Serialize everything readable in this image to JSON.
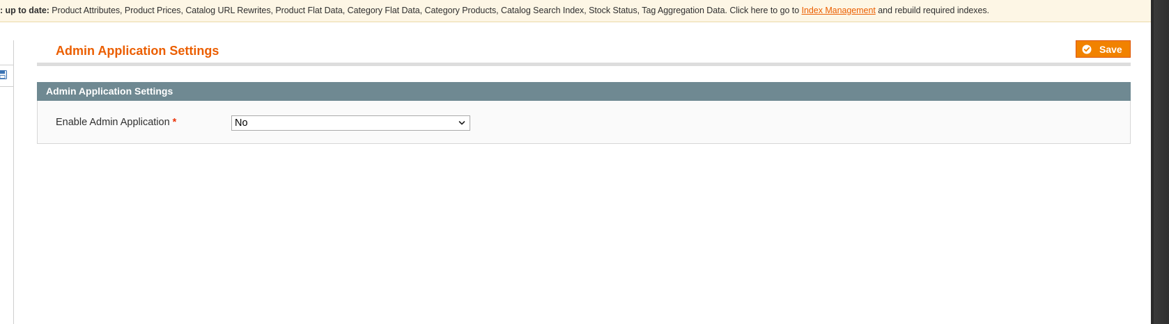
{
  "notice": {
    "prefix": ": up to date:",
    "message": " Product Attributes, Product Prices, Catalog URL Rewrites, Product Flat Data, Category Flat Data, Category Products, Catalog Search Index, Stock Status, Tag Aggregation Data. Click here to go to ",
    "link_text": "Index Management",
    "suffix": " and rebuild required indexes."
  },
  "page": {
    "title": "Admin Application Settings",
    "save_label": "Save"
  },
  "section": {
    "header": "Admin Application Settings",
    "fields": [
      {
        "label": "Enable Admin Application",
        "required_mark": "*",
        "value": "No"
      }
    ]
  },
  "icons": {
    "save_check": "check-circle-icon",
    "chevron": "chevron-down-icon",
    "left_panel": "floppy-disk-icon"
  },
  "colors": {
    "accent": "#eb5e00",
    "button": "#f18200",
    "section_header": "#6f8992",
    "notice_bg": "#fdf6e5",
    "required": "#eb340a"
  }
}
